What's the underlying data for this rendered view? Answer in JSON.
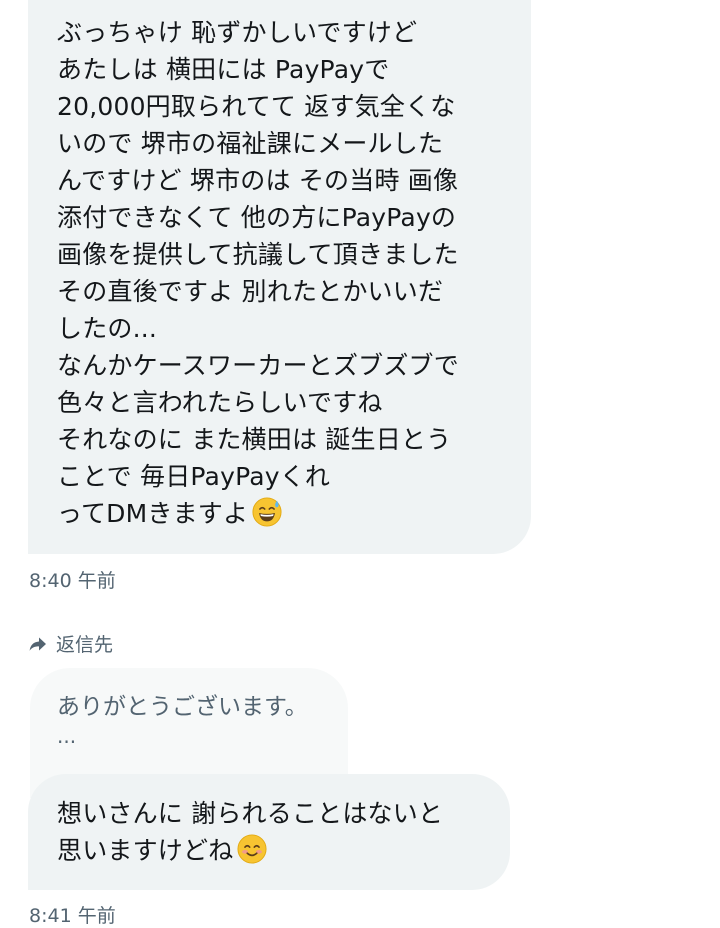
{
  "messages": [
    {
      "lines": [
        "ぶっちゃけ 恥ずかしいですけど",
        "あたしは 横田には PayPayで",
        "20,000円取られてて 返す気全くな",
        "いので 堺市の福祉課にメールした",
        "んですけど 堺市のは その当時 画像",
        "添付できなくて 他の方にPayPayの",
        "画像を提供して抗議して頂きました",
        "その直後ですよ 別れたとかいいだ",
        "したの...",
        "なんかケースワーカーとズブズブで",
        "色々と言われたらしいですね",
        "それなのに また横田は 誕生日とう",
        "ことで 毎日PayPayくれ",
        "ってDMきますよ"
      ],
      "emoji": "grinning-face-with-sweat-emoji",
      "time": "8:40 午前"
    },
    {
      "reply_label": "返信先",
      "quoted_text": "ありがとうございます。",
      "quoted_more": "...",
      "lines": [
        "想いさんに 謝られることはないと",
        "思いますけどね"
      ],
      "emoji": "smiling-face-with-smiling-eyes-emoji",
      "time": "8:41 午前"
    }
  ],
  "colors": {
    "bubble": "#eff3f4",
    "quoted_bubble": "#f7f9f9",
    "text": "#14171a",
    "muted": "#536471"
  }
}
